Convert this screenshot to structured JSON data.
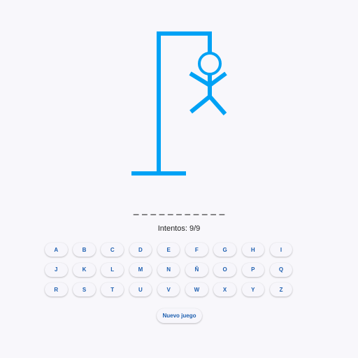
{
  "game": {
    "word_display": "_ _ _ _ _ _ _ _ _ _ _",
    "attempts_label": "Intentos: 9/9",
    "attempts_used": 9,
    "attempts_max": 9,
    "drawing_color": "#00a2f5"
  },
  "keyboard": {
    "rows": [
      [
        "A",
        "B",
        "C",
        "D",
        "E",
        "F",
        "G",
        "H",
        "I"
      ],
      [
        "J",
        "K",
        "L",
        "M",
        "N",
        "Ñ",
        "O",
        "P",
        "Q"
      ],
      [
        "R",
        "S",
        "T",
        "U",
        "V",
        "W",
        "X",
        "Y",
        "Z"
      ]
    ]
  },
  "actions": {
    "new_game_label": "Nuevo juego"
  }
}
